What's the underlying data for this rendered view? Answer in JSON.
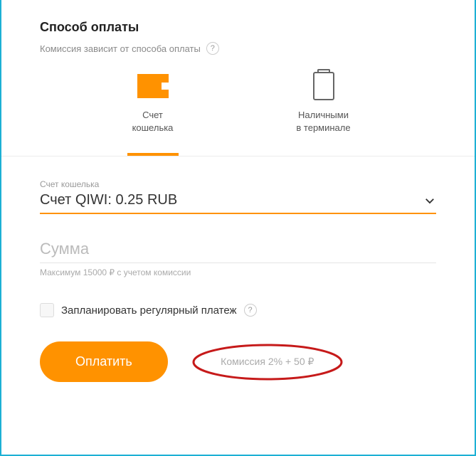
{
  "header": {
    "title": "Способ оплаты",
    "subtitle": "Комиссия зависит от способа оплаты"
  },
  "methods": {
    "wallet": {
      "line1": "Счет",
      "line2": "кошелька"
    },
    "terminal": {
      "line1": "Наличными",
      "line2": "в терминале"
    }
  },
  "account": {
    "label": "Счет кошелька",
    "value": "Счет QIWI: 0.25 RUB"
  },
  "amount": {
    "placeholder": "Сумма",
    "hint": "Максимум 15000 ₽ с учетом комиссии"
  },
  "schedule": {
    "label": "Запланировать регулярный платеж"
  },
  "actions": {
    "pay": "Оплатить",
    "commission": "Комиссия 2% + 50 ₽"
  },
  "glyphs": {
    "help": "?"
  }
}
